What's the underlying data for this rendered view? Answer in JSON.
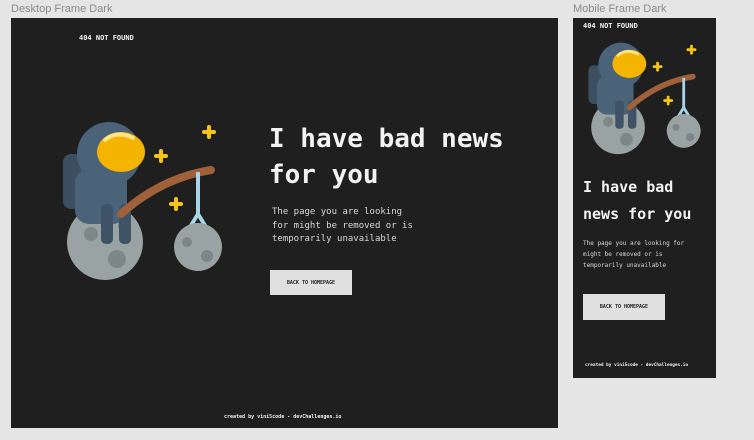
{
  "canvas": {
    "desktop_label": "Desktop Frame Dark",
    "mobile_label": "Mobile Frame Dark"
  },
  "desktop": {
    "brand": "404 NOT FOUND",
    "headline_line1": "I have bad news",
    "headline_line2": "for you",
    "desc_line1": "The page you are looking",
    "desc_line2": "for might be removed or is",
    "desc_line3": "temporarily unavailable",
    "button_label": "BACK TO HOMEPAGE",
    "credit": "created by vini5code - devChallenges.io"
  },
  "mobile": {
    "brand": "404 NOT FOUND",
    "headline_line1": "I have bad",
    "headline_line2": "news for you",
    "desc_line1": "The page you are looking for",
    "desc_line2": "might be removed or is",
    "desc_line3": "temporarily unavailable",
    "button_label": "BACK TO HOMEPAGE",
    "credit": "created by vini5code - devChallenges.io"
  },
  "colors": {
    "frame_bg": "#1f1f1f",
    "canvas_bg": "#e5e5e5",
    "helmet": "#4a6378",
    "visor": "#f4b400",
    "moon": "#9aa3a3",
    "rod": "#a0603a",
    "star": "#f5c518",
    "line": "#a8d4e6"
  },
  "icons": {
    "illustration": "astronaut-fishing-moon-illustration",
    "stars": "sparkle-star-icon"
  }
}
